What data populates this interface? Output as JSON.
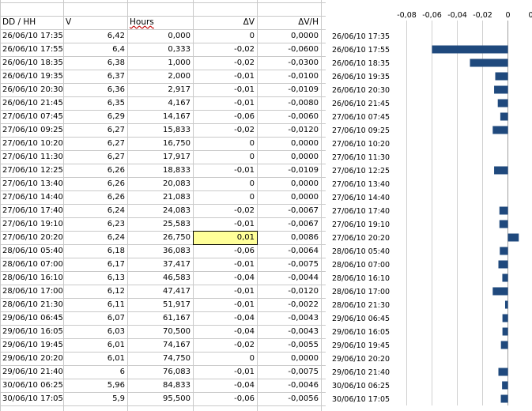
{
  "headers": {
    "date": "DD / HH",
    "v": "V",
    "hours": "Hours",
    "dv": "ΔV",
    "dvh": "ΔV/H"
  },
  "rows": [
    {
      "date": "26/06/10 17:35",
      "v": "6,42",
      "hours": "0,000",
      "dv": "0",
      "dvh": "0,0000",
      "val": 0
    },
    {
      "date": "26/06/10 17:55",
      "v": "6,4",
      "hours": "0,333",
      "dv": "-0,02",
      "dvh": "-0,0600",
      "val": -0.06
    },
    {
      "date": "26/06/10 18:35",
      "v": "6,38",
      "hours": "1,000",
      "dv": "-0,02",
      "dvh": "-0,0300",
      "val": -0.03
    },
    {
      "date": "26/06/10 19:35",
      "v": "6,37",
      "hours": "2,000",
      "dv": "-0,01",
      "dvh": "-0,0100",
      "val": -0.01
    },
    {
      "date": "26/06/10 20:30",
      "v": "6,36",
      "hours": "2,917",
      "dv": "-0,01",
      "dvh": "-0,0109",
      "val": -0.0109
    },
    {
      "date": "26/06/10 21:45",
      "v": "6,35",
      "hours": "4,167",
      "dv": "-0,01",
      "dvh": "-0,0080",
      "val": -0.008
    },
    {
      "date": "27/06/10 07:45",
      "v": "6,29",
      "hours": "14,167",
      "dv": "-0,06",
      "dvh": "-0,0060",
      "val": -0.006
    },
    {
      "date": "27/06/10 09:25",
      "v": "6,27",
      "hours": "15,833",
      "dv": "-0,02",
      "dvh": "-0,0120",
      "val": -0.012
    },
    {
      "date": "27/06/10 10:20",
      "v": "6,27",
      "hours": "16,750",
      "dv": "0",
      "dvh": "0,0000",
      "val": 0
    },
    {
      "date": "27/06/10 11:30",
      "v": "6,27",
      "hours": "17,917",
      "dv": "0",
      "dvh": "0,0000",
      "val": 0
    },
    {
      "date": "27/06/10 12:25",
      "v": "6,26",
      "hours": "18,833",
      "dv": "-0,01",
      "dvh": "-0,0109",
      "val": -0.0109
    },
    {
      "date": "27/06/10 13:40",
      "v": "6,26",
      "hours": "20,083",
      "dv": "0",
      "dvh": "0,0000",
      "val": 0
    },
    {
      "date": "27/06/10 14:40",
      "v": "6,26",
      "hours": "21,083",
      "dv": "0",
      "dvh": "0,0000",
      "val": 0
    },
    {
      "date": "27/06/10 17:40",
      "v": "6,24",
      "hours": "24,083",
      "dv": "-0,02",
      "dvh": "-0,0067",
      "val": -0.0067
    },
    {
      "date": "27/06/10 19:10",
      "v": "6,23",
      "hours": "25,583",
      "dv": "-0,01",
      "dvh": "-0,0067",
      "val": -0.0067
    },
    {
      "date": "27/06/10 20:20",
      "v": "6,24",
      "hours": "26,750",
      "dv": "0,01",
      "dvh": "0,0086",
      "val": 0.0086
    },
    {
      "date": "28/06/10 05:40",
      "v": "6,18",
      "hours": "36,083",
      "dv": "-0,06",
      "dvh": "-0,0064",
      "val": -0.0064
    },
    {
      "date": "28/06/10 07:00",
      "v": "6,17",
      "hours": "37,417",
      "dv": "-0,01",
      "dvh": "-0,0075",
      "val": -0.0075
    },
    {
      "date": "28/06/10 16:10",
      "v": "6,13",
      "hours": "46,583",
      "dv": "-0,04",
      "dvh": "-0,0044",
      "val": -0.0044
    },
    {
      "date": "28/06/10 17:00",
      "v": "6,12",
      "hours": "47,417",
      "dv": "-0,01",
      "dvh": "-0,0120",
      "val": -0.012
    },
    {
      "date": "28/06/10 21:30",
      "v": "6,11",
      "hours": "51,917",
      "dv": "-0,01",
      "dvh": "-0,0022",
      "val": -0.0022
    },
    {
      "date": "29/06/10 06:45",
      "v": "6,07",
      "hours": "61,167",
      "dv": "-0,04",
      "dvh": "-0,0043",
      "val": -0.0043
    },
    {
      "date": "29/06/10 16:05",
      "v": "6,03",
      "hours": "70,500",
      "dv": "-0,04",
      "dvh": "-0,0043",
      "val": -0.0043
    },
    {
      "date": "29/06/10 19:45",
      "v": "6,01",
      "hours": "74,167",
      "dv": "-0,02",
      "dvh": "-0,0055",
      "val": -0.0055
    },
    {
      "date": "29/06/10 20:20",
      "v": "6,01",
      "hours": "74,750",
      "dv": "0",
      "dvh": "0,0000",
      "val": 0
    },
    {
      "date": "29/06/10 21:40",
      "v": "6",
      "hours": "76,083",
      "dv": "-0,01",
      "dvh": "-0,0075",
      "val": -0.0075
    },
    {
      "date": "30/06/10 06:25",
      "v": "5,96",
      "hours": "84,833",
      "dv": "-0,04",
      "dvh": "-0,0046",
      "val": -0.0046
    },
    {
      "date": "30/06/10 17:05",
      "v": "5,9",
      "hours": "95,500",
      "dv": "-0,06",
      "dvh": "-0,0056",
      "val": -0.0056
    }
  ],
  "selected_cell": {
    "row": 15,
    "column": "dv"
  },
  "chart_data": {
    "type": "bar",
    "orientation": "horizontal",
    "categories": [
      "26/06/10 17:35",
      "26/06/10 17:55",
      "26/06/10 18:35",
      "26/06/10 19:35",
      "26/06/10 20:30",
      "26/06/10 21:45",
      "27/06/10 07:45",
      "27/06/10 09:25",
      "27/06/10 10:20",
      "27/06/10 11:30",
      "27/06/10 12:25",
      "27/06/10 13:40",
      "27/06/10 14:40",
      "27/06/10 17:40",
      "27/06/10 19:10",
      "27/06/10 20:20",
      "28/06/10 05:40",
      "28/06/10 07:00",
      "28/06/10 16:10",
      "28/06/10 17:00",
      "28/06/10 21:30",
      "29/06/10 06:45",
      "29/06/10 16:05",
      "29/06/10 19:45",
      "29/06/10 20:20",
      "29/06/10 21:40",
      "30/06/10 06:25",
      "30/06/10 17:05"
    ],
    "values": [
      0,
      -0.06,
      -0.03,
      -0.01,
      -0.0109,
      -0.008,
      -0.006,
      -0.012,
      0,
      0,
      -0.0109,
      0,
      0,
      -0.0067,
      -0.0067,
      0.0086,
      -0.0064,
      -0.0075,
      -0.0044,
      -0.012,
      -0.0022,
      -0.0043,
      -0.0043,
      -0.0055,
      0,
      -0.0075,
      -0.0046,
      -0.0056
    ],
    "xticks": [
      "-0,08",
      "-0,06",
      "-0,04",
      "-0,02",
      "0",
      "0,0"
    ],
    "xlim": [
      -0.08,
      0.02
    ],
    "grid": true,
    "bar_color": "#1f497d",
    "grid_color": "#d0d0d0"
  }
}
